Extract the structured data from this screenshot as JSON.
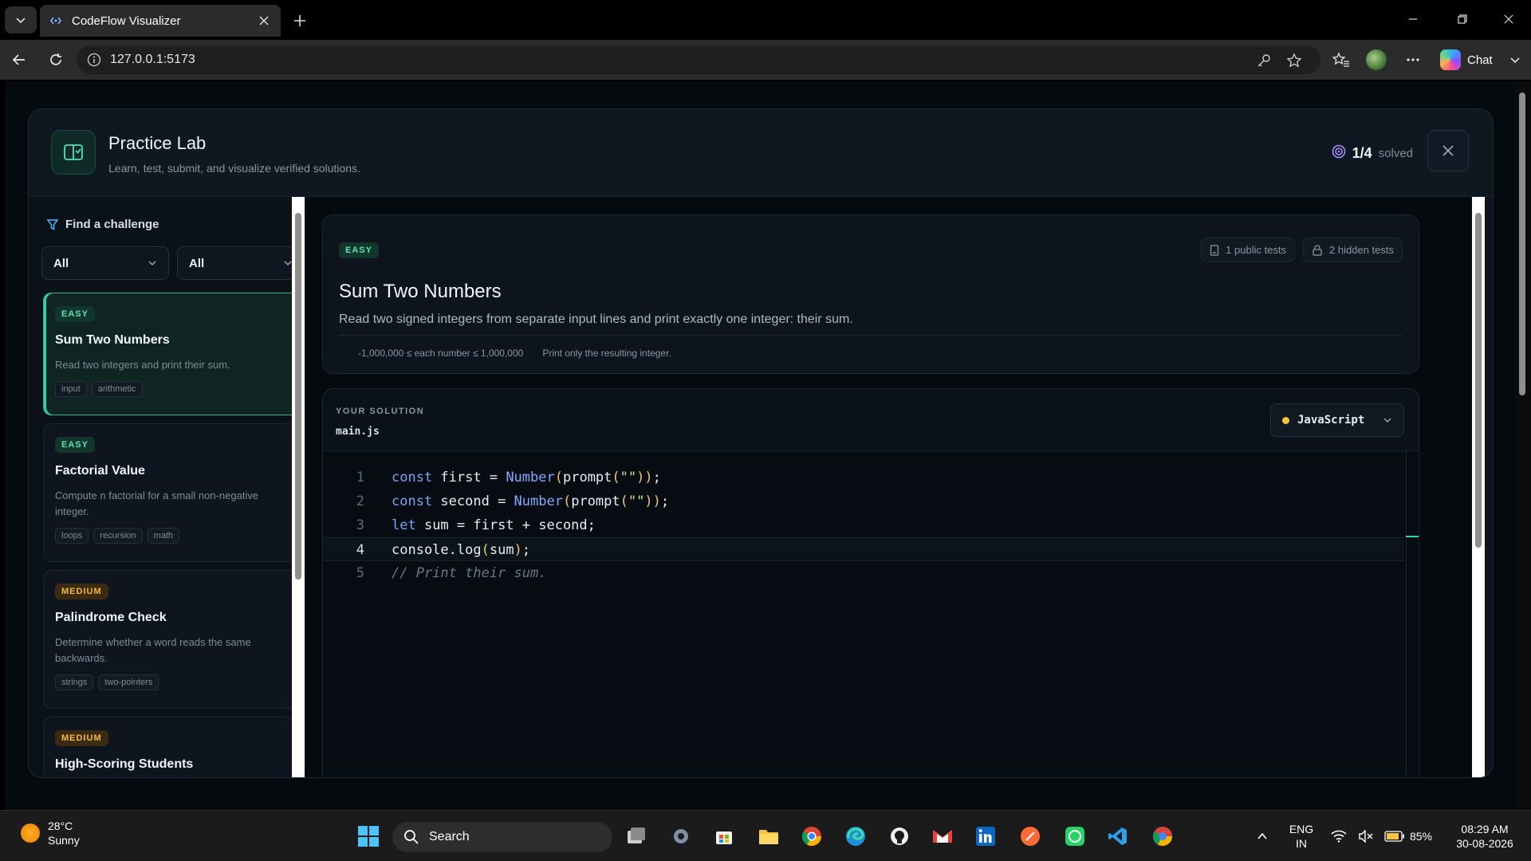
{
  "browser": {
    "tab_title": "CodeFlow Visualizer",
    "url": "127.0.0.1:5173",
    "chat_label": "Chat"
  },
  "header": {
    "title": "Practice Lab",
    "subtitle": "Learn, test, submit, and visualize verified solutions.",
    "solved_count": "1/4",
    "solved_label": "solved"
  },
  "sidebar": {
    "find_label": "Find a challenge",
    "filter_difficulty": "All",
    "filter_topic": "All",
    "challenges": [
      {
        "difficulty": "EASY",
        "title": "Sum Two Numbers",
        "description": "Read two integers and print their sum.",
        "tags": [
          "input",
          "arithmetic"
        ]
      },
      {
        "difficulty": "EASY",
        "title": "Factorial Value",
        "description": "Compute n factorial for a small non-negative integer.",
        "tags": [
          "loops",
          "recursion",
          "math"
        ]
      },
      {
        "difficulty": "MEDIUM",
        "title": "Palindrome Check",
        "description": "Determine whether a word reads the same backwards.",
        "tags": [
          "strings",
          "two-pointers"
        ]
      },
      {
        "difficulty": "MEDIUM",
        "title": "High-Scoring Students",
        "description": "",
        "tags": []
      }
    ]
  },
  "problem": {
    "difficulty": "EASY",
    "title": "Sum Two Numbers",
    "description": "Read two signed integers from separate input lines and print exactly one integer: their sum.",
    "public_tests": "1 public tests",
    "hidden_tests": "2 hidden tests",
    "constraints": [
      "-1,000,000 ≤ each number ≤ 1,000,000",
      "Print only the resulting integer."
    ]
  },
  "editor": {
    "section_label": "YOUR SOLUTION",
    "filename": "main.js",
    "language": "JavaScript",
    "lines": [
      "const first = Number(prompt(\"\"));",
      "const second = Number(prompt(\"\"));",
      "let sum = first + second;",
      "console.log(sum);",
      "// Print their sum."
    ],
    "line_numbers": [
      "1",
      "2",
      "3",
      "4",
      "5"
    ],
    "current_line": 4
  },
  "taskbar": {
    "weather_temp": "28°C",
    "weather_condition": "Sunny",
    "search_label": "Search",
    "lang_top": "ENG",
    "lang_bottom": "IN",
    "battery": "85%",
    "time": "08:29 AM",
    "date": "30-08-2026"
  },
  "colors": {
    "accent": "#2fd4a8",
    "easy": "#5ee0b3",
    "medium": "#f5b942",
    "background": "#050a0f"
  }
}
